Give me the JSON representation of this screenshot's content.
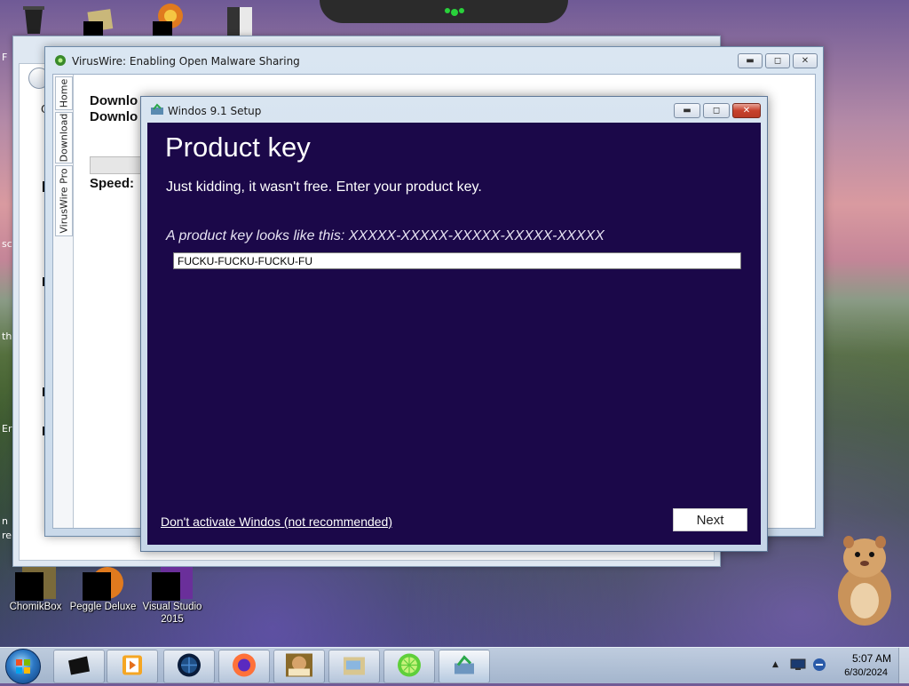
{
  "desktop": {
    "icons": [
      {
        "label": "ChomikBox"
      },
      {
        "label": "Peggle Deluxe"
      },
      {
        "label": "Visual Studio 2015"
      }
    ],
    "edge_text": [
      "F",
      "sc",
      "th",
      "Er",
      "n",
      "re"
    ]
  },
  "back_window": {
    "fragments": [
      "Oi"
    ]
  },
  "viruswire": {
    "title": "VirusWire: Enabling Open Malware Sharing",
    "tabs": [
      "Home",
      "Download",
      "VirusWire Pro"
    ],
    "labels": {
      "download1": "Downlo",
      "download2": "Downlo",
      "speed": "Speed:"
    }
  },
  "setup": {
    "title": "Windos 9.1 Setup",
    "heading": "Product key",
    "subtitle": "Just kidding, it wasn't free. Enter your product key.",
    "hint": "A product key looks like this: XXXXX-XXXXX-XXXXX-XXXXX-XXXXX",
    "input_value": "FUCKU-FUCKU-FUCKU-FU",
    "skip_link": "Don't activate Windos (not recommended)",
    "next_button": "Next"
  },
  "taskbar": {
    "time": "5:07 AM",
    "date": "6/30/2024",
    "apps": [
      "window-app",
      "media-player",
      "globe-app",
      "firefox",
      "chomikbox",
      "folder-app",
      "lime-app",
      "setup-app"
    ]
  },
  "colors": {
    "setup_bg": "#1b0849",
    "accent": "#2c78c4"
  }
}
